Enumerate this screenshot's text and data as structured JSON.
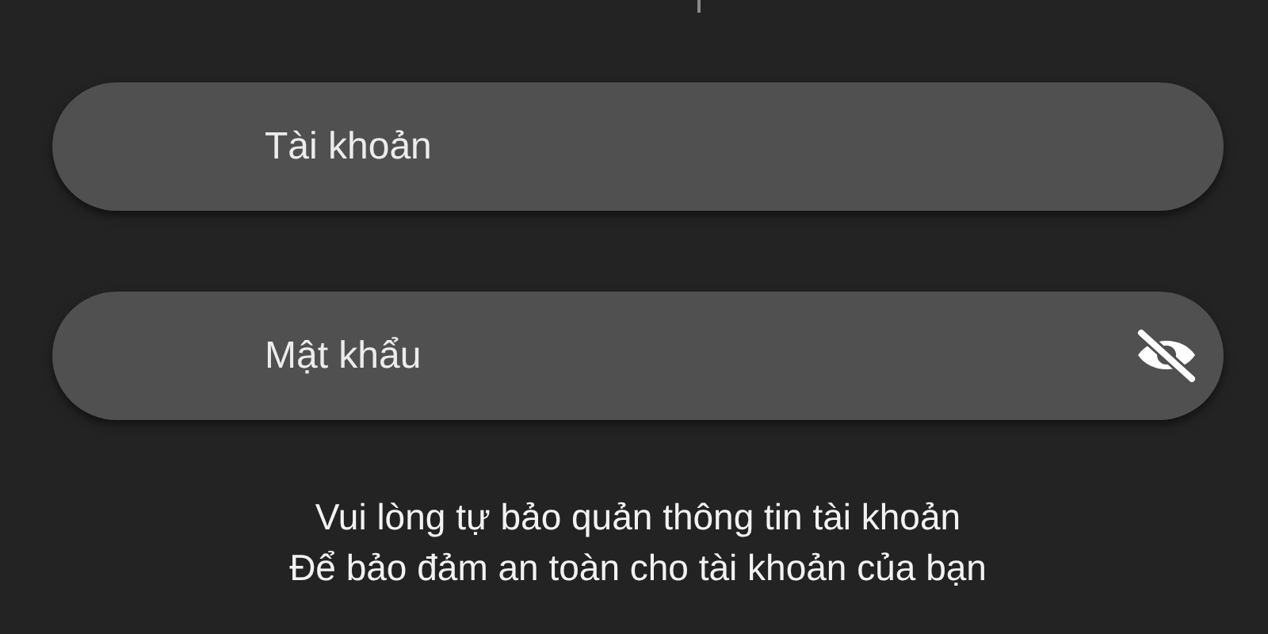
{
  "fields": [
    {
      "placeholder": "Tài khoản",
      "password_toggle": false
    },
    {
      "placeholder": "Mật khẩu",
      "password_toggle": true
    }
  ],
  "notes": [
    "Vui lòng tự bảo quản thông tin tài khoản",
    "Để bảo đảm an toàn cho tài khoản của bạn"
  ]
}
